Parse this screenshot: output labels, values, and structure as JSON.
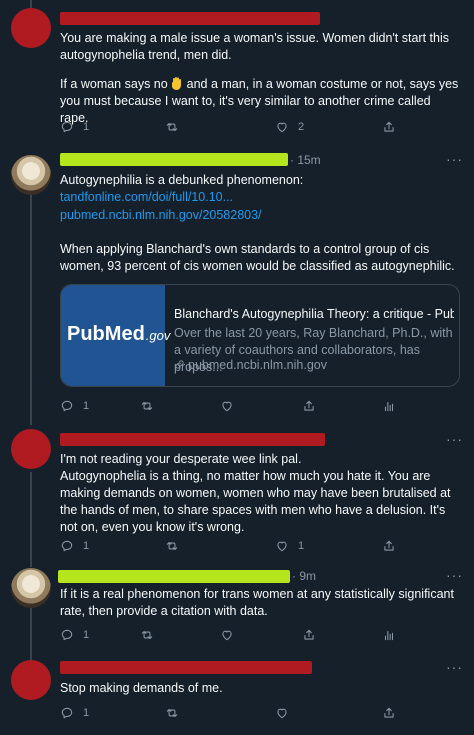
{
  "tweets": [
    {
      "text": "You are making a male issue a woman's issue. Women didn't start this autogynophelia trend, men did.",
      "text2_before": "If a woman says no ",
      "text2_after": " and a man, in a woman costume or not, says yes you must because I want to, it's very similar to another crime called rape.",
      "reply_count": "1",
      "like_count": "2"
    },
    {
      "time": "· 15m",
      "text": "Autogynephilia is a debunked phenomenon:",
      "link1": "tandfonline.com/doi/full/10.10...",
      "link2": "pubmed.ncbi.nlm.nih.gov/20582803/",
      "text2": "When applying Blanchard's own standards to a control group of cis women, 93 percent of cis women would be classified as autogynephilic.",
      "card": {
        "logo_pub": "Pub",
        "logo_med": "Med",
        "logo_gov": ".gov",
        "title": "Blanchard's Autogynephilia Theory: a critique - Pub...",
        "description": "Over the last 20 years, Ray Blanchard, Ph.D., with a variety of coauthors and collaborators, has propos...",
        "domain": "pubmed.ncbi.nlm.nih.gov"
      },
      "reply_count": "1"
    },
    {
      "text": "I'm not reading your desperate wee link pal.\nAutogynophelia is a thing, no matter how much you hate it. You are making demands on women, women who may have been brutalised at the hands of men, to share spaces with men who have a delusion. It's not on, even you know it's wrong.",
      "reply_count": "1",
      "like_count": "1"
    },
    {
      "time": "· 9m",
      "text": "If it is a real phenomenon for trans women at any statistically significant rate, then provide a citation with data.",
      "reply_count": "1"
    },
    {
      "text": "Stop making demands of me.",
      "reply_count": "1"
    }
  ],
  "more_glyph": "···",
  "colors": {
    "background": "#15202b",
    "muted": "#8b98a5",
    "link": "#1d9bf0",
    "red_redaction": "#b01b22",
    "green_redaction": "#b5e61d",
    "pubmed_blue": "#205493"
  }
}
